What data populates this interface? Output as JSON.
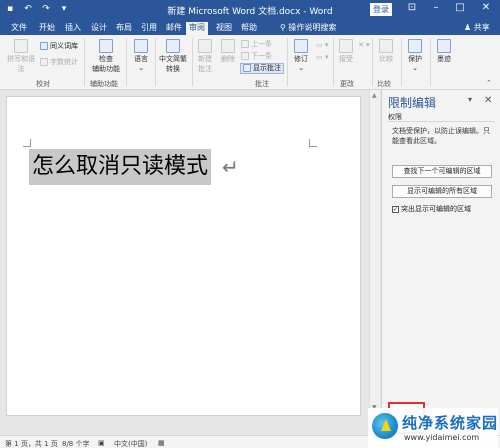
{
  "title_bar": {
    "document_title": "新建 Microsoft Word 文档.docx - Word",
    "login_label": "登录",
    "qat_icons": [
      "save-icon",
      "undo-icon",
      "redo-icon",
      "customize-qat-icon"
    ],
    "window_controls": [
      "ribbon-display-icon",
      "minimize-icon",
      "maximize-icon",
      "close-icon"
    ],
    "colors": {
      "title_bar_bg": "#2b579a",
      "accent": "#2b579a"
    }
  },
  "tabs": {
    "items": [
      "文件",
      "开始",
      "插入",
      "设计",
      "布局",
      "引用",
      "邮件",
      "审阅",
      "视图",
      "帮助"
    ],
    "active": "审阅",
    "tell_me": "操作说明搜索",
    "share": "共享"
  },
  "ribbon": {
    "proofing": {
      "spelling": "拼写和语法",
      "thesaurus": "同义词库",
      "word_count": "字数统计",
      "label": "校对"
    },
    "accessibility": {
      "check": "检查",
      "check_line2": "辅助功能",
      "label": "辅助功能"
    },
    "language": {
      "language": "语言"
    },
    "chinese": {
      "convert": "中文简繁",
      "convert_line2": "转换"
    },
    "comments": {
      "new": "新建",
      "new_line2": "批注",
      "delete": "删除",
      "prev": "上一条",
      "next": "下一条",
      "show": "显示批注",
      "label": "批注"
    },
    "tracking": {
      "track": "修订"
    },
    "changes": {
      "accept": "接受",
      "label": "更改"
    },
    "compare": {
      "compare": "比较",
      "label": "比较"
    },
    "protect": {
      "protect": "保护"
    },
    "ink": {
      "ink": "墨迹"
    }
  },
  "document": {
    "text": "怎么取消只读模式",
    "paragraph_mark": "↵"
  },
  "restrict_pane": {
    "title": "限制编辑",
    "subtitle": "权限",
    "description": "文档受保护，以防止误编辑。只能查看此区域。",
    "find_next_button": "查找下一个可编辑的区域",
    "show_all_button": "显示可编辑的所有区域",
    "highlight_checkbox": "突出显示可编辑的区域",
    "highlight_checked": true,
    "close_icon": "close-icon",
    "menu_icon": "chevron-down-icon"
  },
  "status_bar": {
    "page": "第 1 页，共 1 页",
    "words": "8/8 个字",
    "language": "中文(中国)"
  },
  "watermark": {
    "name": "纯净系统家园",
    "url": "www.yidaimei.com"
  }
}
